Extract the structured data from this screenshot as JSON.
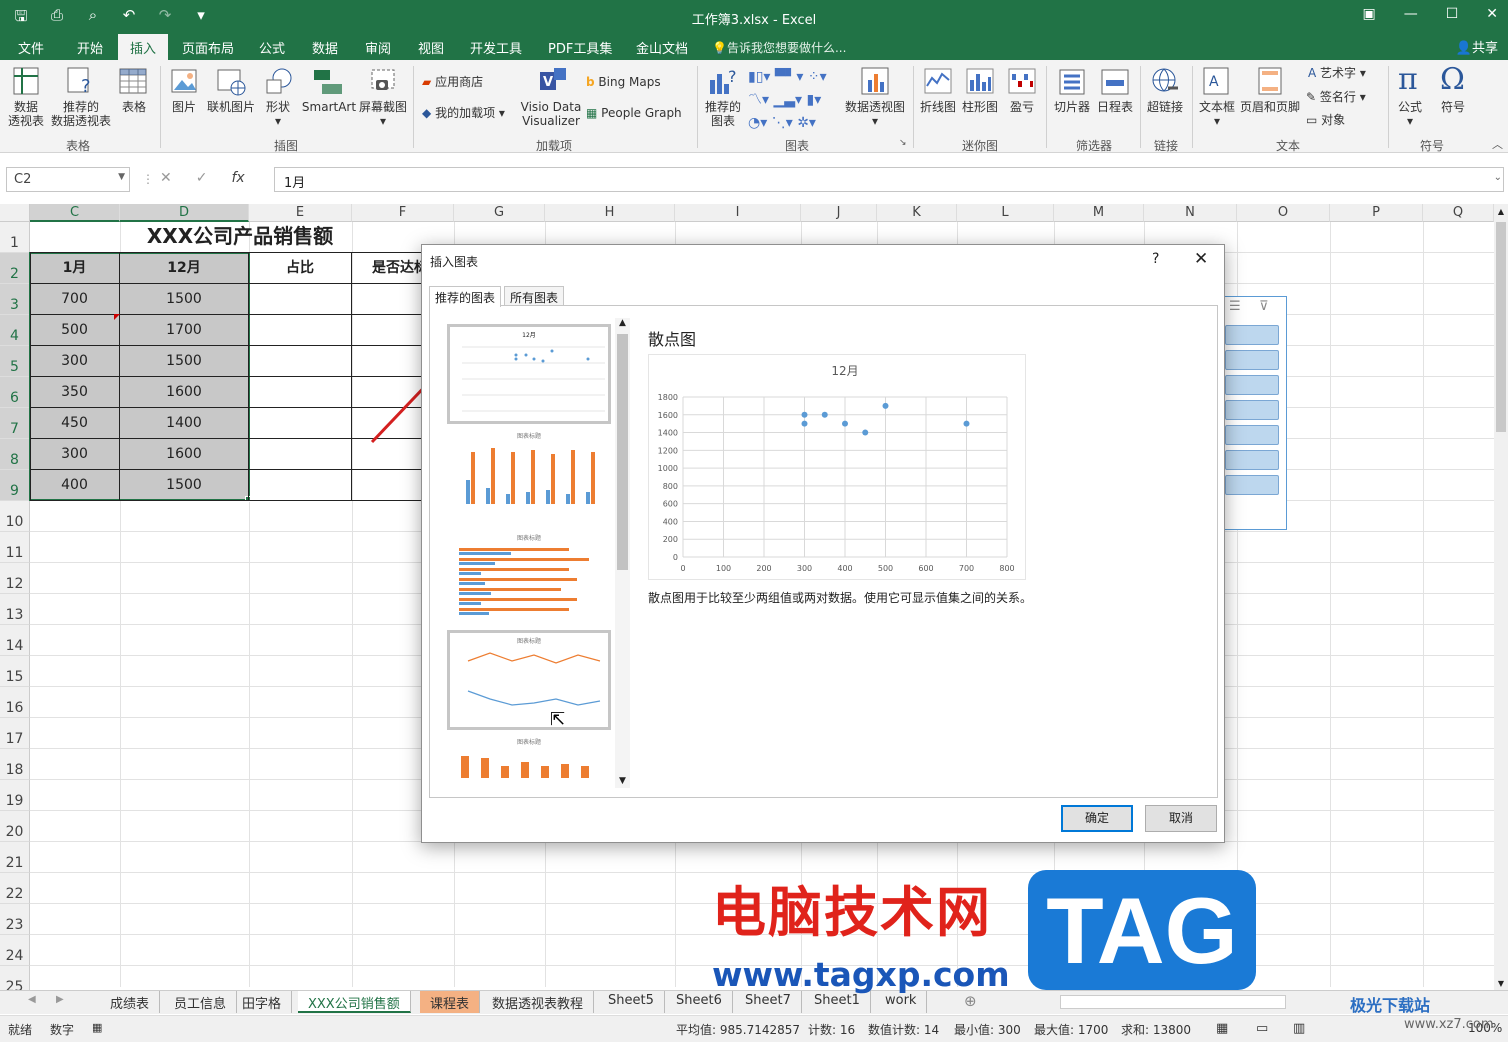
{
  "window": {
    "title": "工作簿3.xlsx - Excel",
    "qat_icons": [
      "save-icon",
      "print-preview-icon",
      "print-icon",
      "undo-icon",
      "redo-icon",
      "customize-icon"
    ]
  },
  "menu": {
    "tabs": [
      "文件",
      "开始",
      "插入",
      "页面布局",
      "公式",
      "数据",
      "审阅",
      "视图",
      "开发工具",
      "PDF工具集",
      "金山文档"
    ],
    "active": "插入",
    "tellme": "告诉我您想要做什么...",
    "share": "共享"
  },
  "ribbon": {
    "table": {
      "pivot": "数据\n透视表",
      "recommended_pivot": "推荐的\n数据透视表",
      "table": "表格",
      "group": "表格"
    },
    "illustrations": {
      "pictures": "图片",
      "online_pictures": "联机图片",
      "shapes": "形状",
      "smartart": "SmartArt",
      "screenshot": "屏幕截图",
      "group": "插图"
    },
    "addins": {
      "store": "应用商店",
      "my_addins": "我的加载项",
      "visio": "Visio Data\nVisualizer",
      "bing": "Bing Maps",
      "people": "People Graph",
      "group": "加载项"
    },
    "charts": {
      "recommended": "推荐的\n图表",
      "pivot_chart": "数据透视图",
      "group": "图表"
    },
    "sparklines": {
      "line": "折线图",
      "column": "柱形图",
      "winloss": "盈亏",
      "group": "迷你图"
    },
    "filters": {
      "slicer": "切片器",
      "timeline": "日程表",
      "group": "筛选器"
    },
    "links": {
      "hyperlink": "超链接",
      "group": "链接"
    },
    "text": {
      "textbox": "文本框",
      "header_footer": "页眉和页脚",
      "wordart": "艺术字",
      "signature": "签名行",
      "object": "对象",
      "group": "文本"
    },
    "symbols": {
      "equation": "公式",
      "symbol": "符号",
      "group": "符号"
    }
  },
  "formula_bar": {
    "name_box": "C2",
    "content": "1月"
  },
  "columns": [
    "C",
    "D",
    "E",
    "F",
    "G",
    "H",
    "I",
    "J",
    "K",
    "L",
    "M",
    "N",
    "O",
    "P",
    "Q"
  ],
  "rows": [
    "1",
    "2",
    "3",
    "4",
    "5",
    "6",
    "7",
    "8",
    "9",
    "10",
    "11",
    "12",
    "13",
    "14",
    "15",
    "16",
    "17",
    "18",
    "19",
    "20",
    "21",
    "22",
    "23",
    "24",
    "25"
  ],
  "sheet": {
    "title": "XXX公司产品销售额",
    "headers": [
      "1月",
      "12月",
      "占比",
      "是否达标"
    ],
    "jan": [
      "700",
      "500",
      "300",
      "350",
      "450",
      "300",
      "400"
    ],
    "dec": [
      "1500",
      "1700",
      "1500",
      "1600",
      "1400",
      "1600",
      "1500"
    ]
  },
  "dialog": {
    "title": "插入图表",
    "help": "?",
    "tabs": [
      "推荐的图表",
      "所有图表"
    ],
    "chart_name": "散点图",
    "description": "散点图用于比较至少两组值或两对数据。使用它可显示值集之间的关系。",
    "ok": "确定",
    "cancel": "取消",
    "thumb_titles": [
      "12月",
      "图表标题",
      "图表标题",
      "图表标题",
      "图表标题"
    ]
  },
  "chart_data": {
    "type": "scatter",
    "title": "12月",
    "x": [
      700,
      500,
      300,
      350,
      450,
      300,
      400
    ],
    "y": [
      1500,
      1700,
      1500,
      1600,
      1400,
      1600,
      1500
    ],
    "xlim": [
      0,
      800
    ],
    "ylim": [
      0,
      1800
    ],
    "x_ticks": [
      "0",
      "100",
      "200",
      "300",
      "400",
      "500",
      "600",
      "700",
      "800"
    ],
    "y_ticks": [
      "0",
      "200",
      "400",
      "600",
      "800",
      "1000",
      "1200",
      "1400",
      "1600",
      "1800"
    ],
    "grid": true,
    "color": "#5b9bd5"
  },
  "sheet_tabs": [
    "成绩表",
    "员工信息",
    "田字格",
    "XXX公司销售额",
    "课程表",
    "数据透视表教程",
    "Sheet5",
    "Sheet6",
    "Sheet7",
    "Sheet1",
    "work"
  ],
  "active_sheet": "XXX公司销售额",
  "status": {
    "ready": "就绪",
    "mode": "数字",
    "average": "平均值: 985.7142857",
    "count": "计数: 16",
    "numcount": "数值计数: 14",
    "min": "最小值: 300",
    "max": "最大值: 1700",
    "sum": "求和: 13800",
    "zoom": "100%"
  },
  "watermark": {
    "text": "电脑技术网",
    "url": "www.tagxp.com",
    "tag": "TAG",
    "logo": "极光下载站",
    "logo_url": "www.xz7.com"
  }
}
